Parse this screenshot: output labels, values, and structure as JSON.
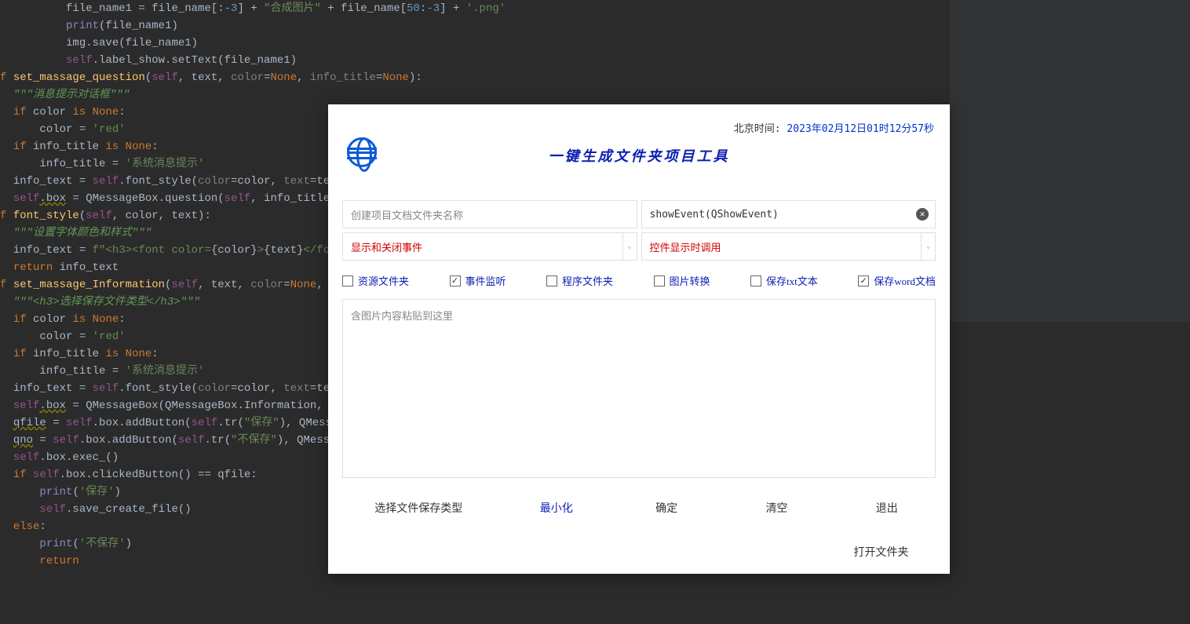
{
  "code": {
    "lines": [
      {
        "indent": 10,
        "parts": [
          {
            "t": "file_name1 = file_name[:"
          },
          {
            "t": "-3",
            "c": "num"
          },
          {
            "t": "] + "
          },
          {
            "t": "\"合成图片\"",
            "c": "str"
          },
          {
            "t": " + file_name["
          },
          {
            "t": "50",
            "c": "num"
          },
          {
            "t": ":"
          },
          {
            "t": "-3",
            "c": "num"
          },
          {
            "t": "] + "
          },
          {
            "t": "'.png'",
            "c": "str"
          }
        ]
      },
      {
        "indent": 10,
        "parts": [
          {
            "t": "print",
            "c": "builtin"
          },
          {
            "t": "(file_name1)"
          }
        ]
      },
      {
        "indent": 10,
        "parts": [
          {
            "t": "img.save(file_name1)"
          }
        ]
      },
      {
        "indent": 10,
        "parts": [
          {
            "t": "self",
            "c": "self"
          },
          {
            "t": ".label_show.setText(file_name1)"
          }
        ]
      },
      {
        "indent": 0,
        "parts": [
          {
            "t": ""
          }
        ]
      },
      {
        "indent": 0,
        "parts": [
          {
            "t": "f ",
            "c": "kw"
          },
          {
            "t": "set_massage_question",
            "c": "func"
          },
          {
            "t": "("
          },
          {
            "t": "self",
            "c": "self"
          },
          {
            "t": ", text, "
          },
          {
            "t": "color",
            "c": "named"
          },
          {
            "t": "="
          },
          {
            "t": "None",
            "c": "kw"
          },
          {
            "t": ", "
          },
          {
            "t": "info_title",
            "c": "named"
          },
          {
            "t": "="
          },
          {
            "t": "None",
            "c": "kw"
          },
          {
            "t": "):"
          }
        ]
      },
      {
        "indent": 2,
        "parts": [
          {
            "t": "\"\"\"消息提示对话框\"\"\"",
            "c": "docstr"
          }
        ]
      },
      {
        "indent": 2,
        "parts": [
          {
            "t": "if ",
            "c": "kw"
          },
          {
            "t": "color "
          },
          {
            "t": "is ",
            "c": "kw"
          },
          {
            "t": "None",
            "c": "kw"
          },
          {
            "t": ":"
          }
        ]
      },
      {
        "indent": 6,
        "parts": [
          {
            "t": "color = "
          },
          {
            "t": "'red'",
            "c": "str"
          }
        ]
      },
      {
        "indent": 2,
        "parts": [
          {
            "t": "if ",
            "c": "kw"
          },
          {
            "t": "info_title "
          },
          {
            "t": "is ",
            "c": "kw"
          },
          {
            "t": "None",
            "c": "kw"
          },
          {
            "t": ":"
          }
        ]
      },
      {
        "indent": 6,
        "parts": [
          {
            "t": "info_title = "
          },
          {
            "t": "'系统消息提示'",
            "c": "str"
          }
        ]
      },
      {
        "indent": 2,
        "parts": [
          {
            "t": "info_text = "
          },
          {
            "t": "self",
            "c": "self"
          },
          {
            "t": ".font_style("
          },
          {
            "t": "color",
            "c": "named"
          },
          {
            "t": "=color, "
          },
          {
            "t": "text",
            "c": "named"
          },
          {
            "t": "=text)"
          }
        ]
      },
      {
        "indent": 2,
        "parts": [
          {
            "t": "self",
            "c": "self"
          },
          {
            "t": ".box",
            "c": "warn"
          },
          {
            "t": " = QMessageBox.question("
          },
          {
            "t": "self",
            "c": "self"
          },
          {
            "t": ", info_title, i"
          }
        ]
      },
      {
        "indent": 0,
        "parts": [
          {
            "t": ""
          }
        ]
      },
      {
        "indent": 0,
        "parts": [
          {
            "t": "f ",
            "c": "kw"
          },
          {
            "t": "font_style",
            "c": "func"
          },
          {
            "t": "("
          },
          {
            "t": "self",
            "c": "self"
          },
          {
            "t": ", color, text):"
          }
        ]
      },
      {
        "indent": 2,
        "parts": [
          {
            "t": "\"\"\"设置字体颜色和样式\"\"\"",
            "c": "docstr"
          }
        ]
      },
      {
        "indent": 2,
        "parts": [
          {
            "t": "info_text = "
          },
          {
            "t": "f\"<h3><font color=",
            "c": "str"
          },
          {
            "t": "{"
          },
          {
            "t": "color"
          },
          {
            "t": "}"
          },
          {
            "t": ">",
            "c": "str"
          },
          {
            "t": "{"
          },
          {
            "t": "text"
          },
          {
            "t": "}"
          },
          {
            "t": "</font",
            "c": "str"
          }
        ]
      },
      {
        "indent": 2,
        "parts": [
          {
            "t": "return ",
            "c": "kw"
          },
          {
            "t": "info_text"
          }
        ]
      },
      {
        "indent": 0,
        "parts": [
          {
            "t": ""
          }
        ]
      },
      {
        "indent": 0,
        "parts": [
          {
            "t": "f ",
            "c": "kw"
          },
          {
            "t": "set_massage_Information",
            "c": "func"
          },
          {
            "t": "("
          },
          {
            "t": "self",
            "c": "self"
          },
          {
            "t": ", text, "
          },
          {
            "t": "color",
            "c": "named"
          },
          {
            "t": "="
          },
          {
            "t": "None",
            "c": "kw"
          },
          {
            "t": ", inf"
          }
        ]
      },
      {
        "indent": 2,
        "parts": [
          {
            "t": "\"\"\"<h3>选择保存文件类型</h3>\"\"\"",
            "c": "docstr"
          }
        ]
      },
      {
        "indent": 2,
        "parts": [
          {
            "t": "if ",
            "c": "kw"
          },
          {
            "t": "color "
          },
          {
            "t": "is ",
            "c": "kw"
          },
          {
            "t": "None",
            "c": "kw"
          },
          {
            "t": ":"
          }
        ]
      },
      {
        "indent": 6,
        "parts": [
          {
            "t": "color = "
          },
          {
            "t": "'red'",
            "c": "str"
          }
        ]
      },
      {
        "indent": 2,
        "parts": [
          {
            "t": "if ",
            "c": "kw"
          },
          {
            "t": "info_title "
          },
          {
            "t": "is ",
            "c": "kw"
          },
          {
            "t": "None",
            "c": "kw"
          },
          {
            "t": ":"
          }
        ]
      },
      {
        "indent": 6,
        "parts": [
          {
            "t": "info_title = "
          },
          {
            "t": "'系统消息提示'",
            "c": "str"
          }
        ]
      },
      {
        "indent": 2,
        "parts": [
          {
            "t": "info_text = "
          },
          {
            "t": "self",
            "c": "self"
          },
          {
            "t": ".font_style("
          },
          {
            "t": "color",
            "c": "named"
          },
          {
            "t": "=color, "
          },
          {
            "t": "text",
            "c": "named"
          },
          {
            "t": "=text)"
          }
        ]
      },
      {
        "indent": 2,
        "parts": [
          {
            "t": "self",
            "c": "self"
          },
          {
            "t": ".box",
            "c": "warn"
          },
          {
            "t": " = QMessageBox(QMessageBox.Information, inf"
          }
        ]
      },
      {
        "indent": 2,
        "parts": [
          {
            "t": "qfile",
            "c": "warn"
          },
          {
            "t": " = "
          },
          {
            "t": "self",
            "c": "self"
          },
          {
            "t": ".box.addButton("
          },
          {
            "t": "self",
            "c": "self"
          },
          {
            "t": ".tr("
          },
          {
            "t": "\"保存\"",
            "c": "str"
          },
          {
            "t": "), QMessage"
          }
        ]
      },
      {
        "indent": 2,
        "parts": [
          {
            "t": "qno",
            "c": "warn"
          },
          {
            "t": " = "
          },
          {
            "t": "self",
            "c": "self"
          },
          {
            "t": ".box.addButton("
          },
          {
            "t": "self",
            "c": "self"
          },
          {
            "t": ".tr("
          },
          {
            "t": "\"不保存\"",
            "c": "str"
          },
          {
            "t": "), QMessage"
          }
        ]
      },
      {
        "indent": 2,
        "parts": [
          {
            "t": "self",
            "c": "self"
          },
          {
            "t": ".box.exec_()"
          }
        ]
      },
      {
        "indent": 2,
        "parts": [
          {
            "t": "if ",
            "c": "kw"
          },
          {
            "t": "self",
            "c": "self"
          },
          {
            "t": ".box.clickedButton() == qfile:"
          }
        ]
      },
      {
        "indent": 6,
        "parts": [
          {
            "t": "print",
            "c": "builtin"
          },
          {
            "t": "("
          },
          {
            "t": "'保存'",
            "c": "str"
          },
          {
            "t": ")"
          }
        ]
      },
      {
        "indent": 6,
        "parts": [
          {
            "t": "self",
            "c": "self"
          },
          {
            "t": ".save_create_file()"
          }
        ]
      },
      {
        "indent": 2,
        "parts": [
          {
            "t": "else",
            "c": "kw"
          },
          {
            "t": ":"
          }
        ]
      },
      {
        "indent": 6,
        "parts": [
          {
            "t": "print",
            "c": "builtin"
          },
          {
            "t": "("
          },
          {
            "t": "'不保存'",
            "c": "str"
          },
          {
            "t": ")"
          }
        ]
      },
      {
        "indent": 6,
        "parts": [
          {
            "t": "return",
            "c": "kw"
          }
        ]
      }
    ]
  },
  "dialog": {
    "clock_label": "北京时间: ",
    "clock_time": "2023年02月12日01时12分57秒",
    "title": "一键生成文件夹项目工具",
    "input1_placeholder": "创建项目文档文件夹名称",
    "input2_value": "showEvent(QShowEvent)",
    "combo1": "显示和关闭事件",
    "combo2": "控件显示时调用",
    "checks": [
      {
        "label": "资源文件夹",
        "checked": false
      },
      {
        "label": "事件监听",
        "checked": true
      },
      {
        "label": "程序文件夹",
        "checked": false
      },
      {
        "label": "图片转换",
        "checked": false
      },
      {
        "label": "保存txt文本",
        "checked": false
      },
      {
        "label": "保存word文档",
        "checked": true
      }
    ],
    "textarea_placeholder": "含图片内容粘贴到这里",
    "buttons": {
      "select_type": "选择文件保存类型",
      "minimize": "最小化",
      "ok": "确定",
      "clear": "清空",
      "exit": "退出",
      "open_folder": "打开文件夹"
    }
  }
}
